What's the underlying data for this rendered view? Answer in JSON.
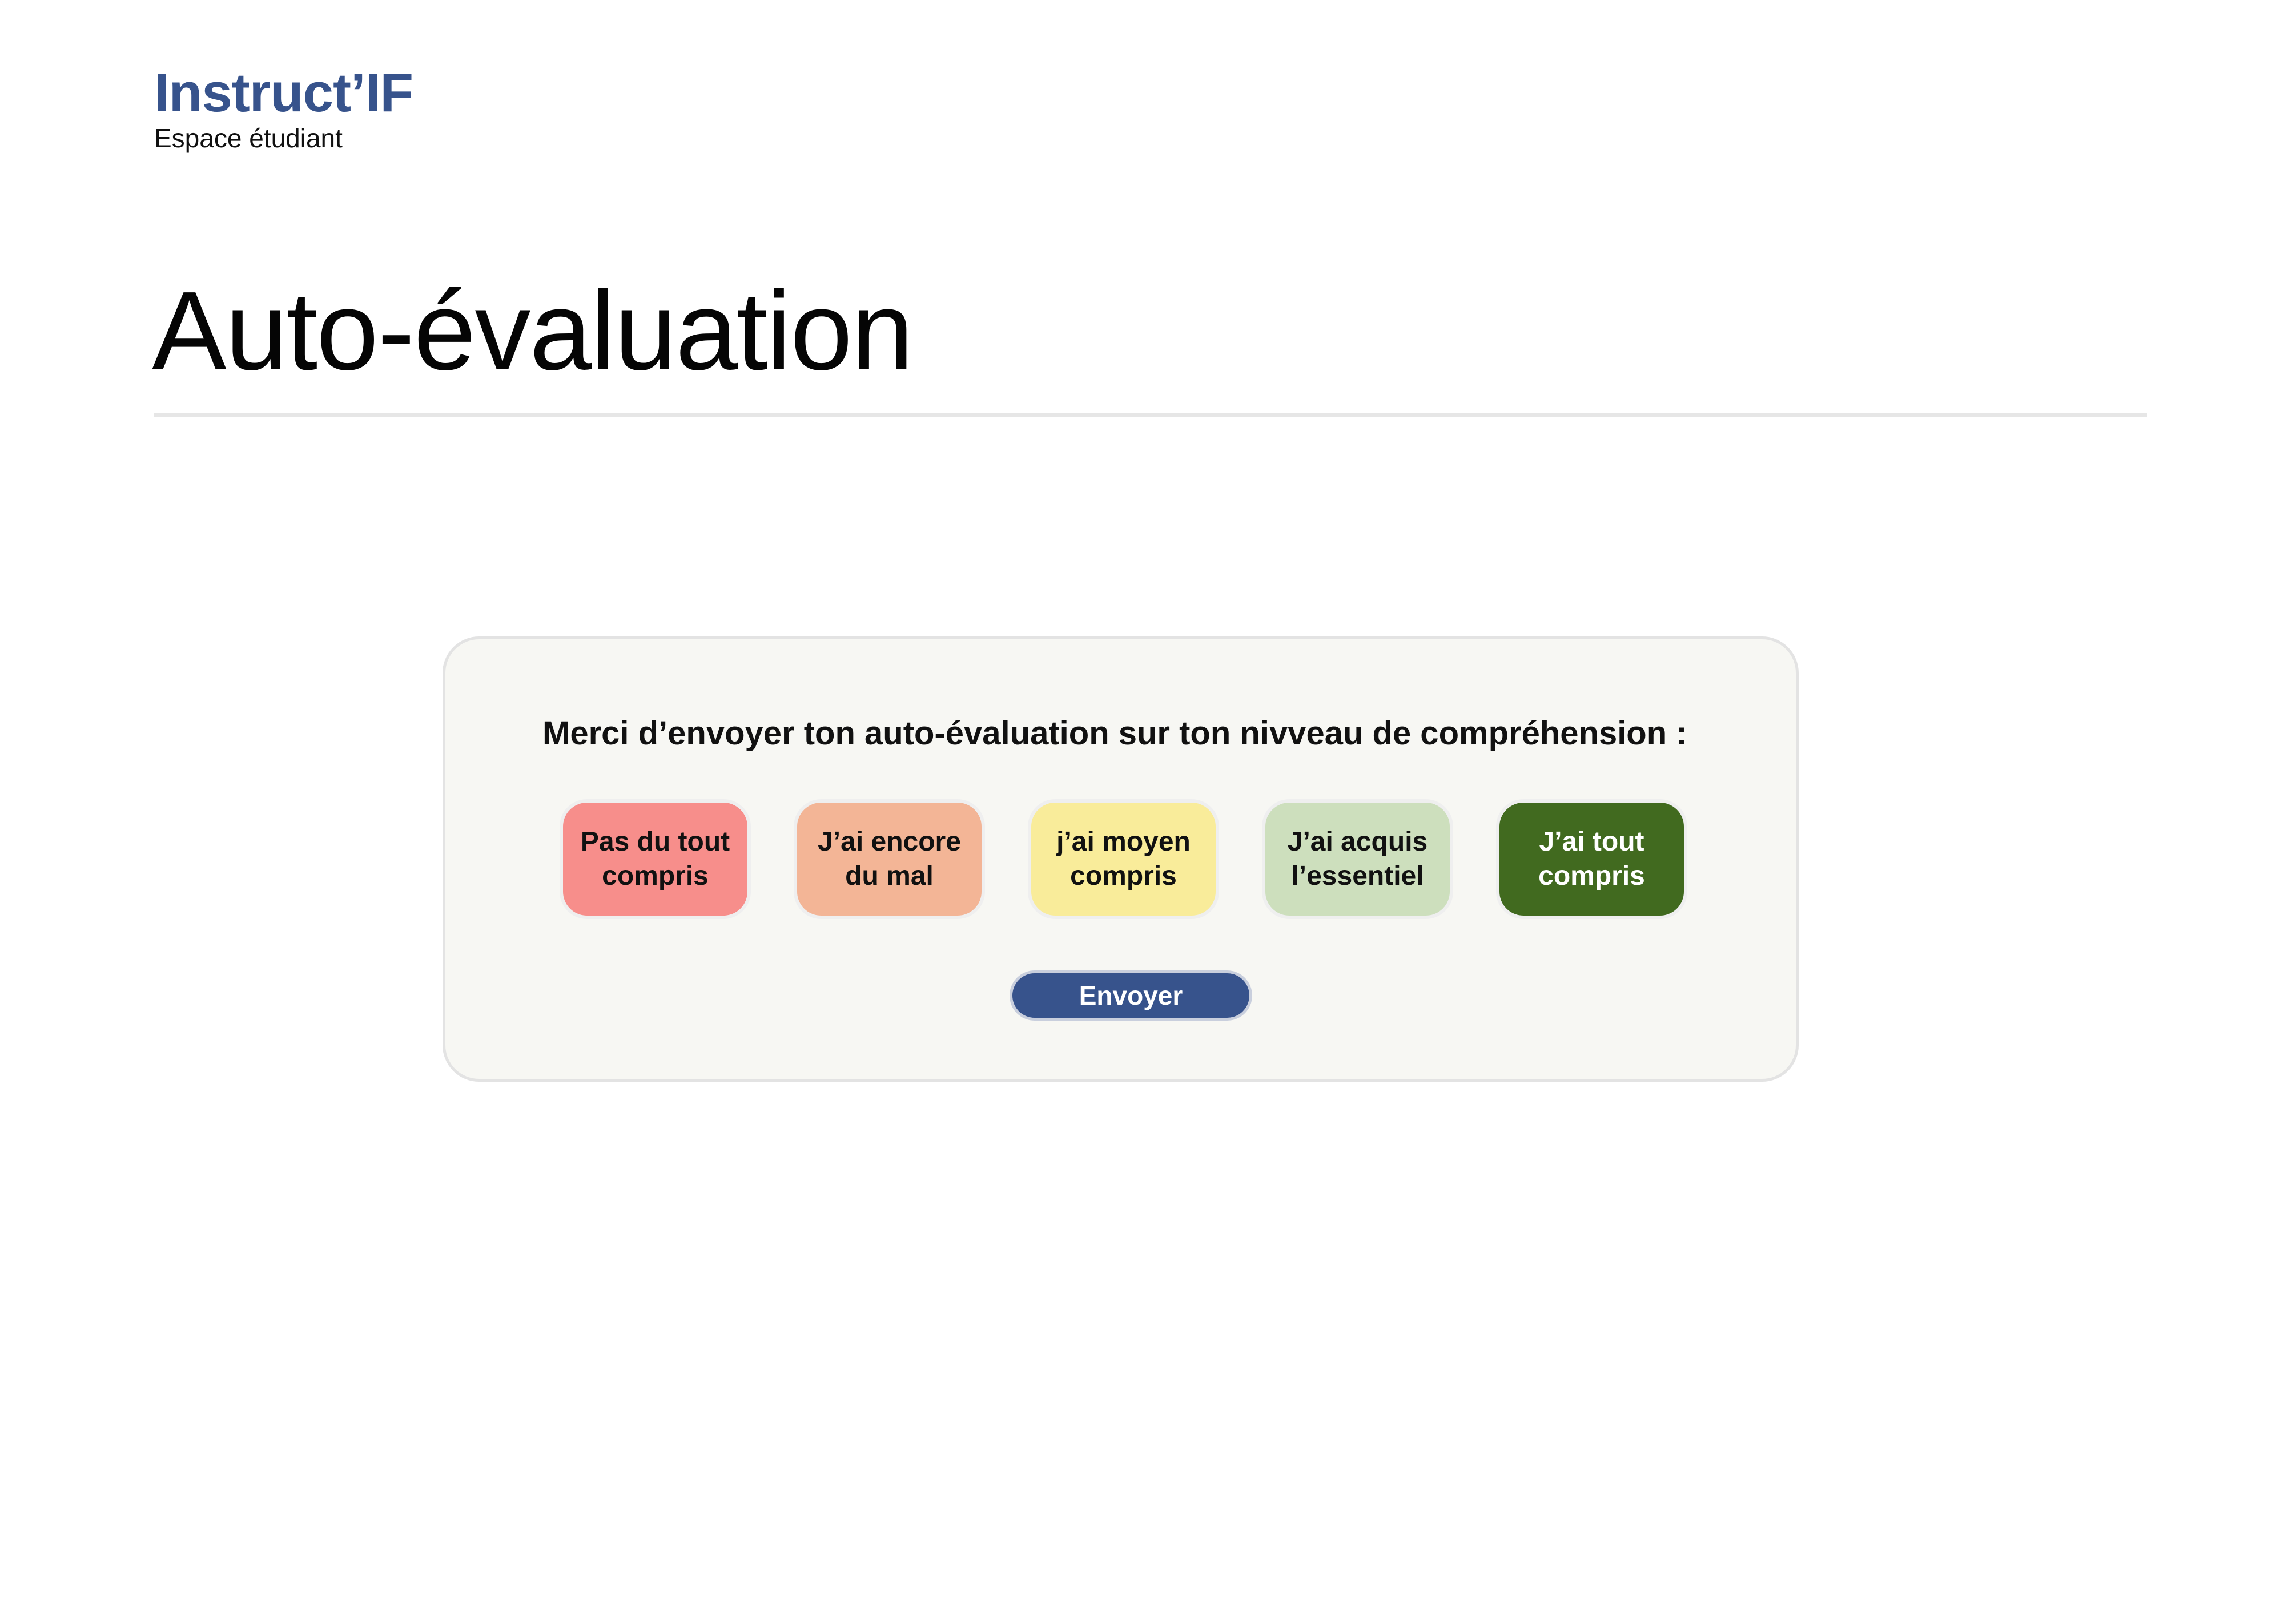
{
  "brand": {
    "name": "Instruct’IF",
    "subtitle": "Espace étudiant",
    "color": "#37538c"
  },
  "page": {
    "title": "Auto-évaluation"
  },
  "evaluation": {
    "prompt": "Merci d’envoyer ton auto-évaluation sur ton nivveau de compréhension :",
    "options": [
      {
        "label": "Pas du tout compris",
        "color": "#f78e8b",
        "text_color": "#111111"
      },
      {
        "label": "J’ai encore du mal",
        "color": "#f3b596",
        "text_color": "#111111"
      },
      {
        "label": "j’ai moyen compris",
        "color": "#f9ec9a",
        "text_color": "#111111"
      },
      {
        "label": "J’ai acquis l’essentiel",
        "color": "#cddfbd",
        "text_color": "#111111"
      },
      {
        "label": "J’ai tout compris",
        "color": "#416a1f",
        "text_color": "#ffffff"
      }
    ],
    "submit_label": "Envoyer",
    "submit_color": "#37538c"
  }
}
